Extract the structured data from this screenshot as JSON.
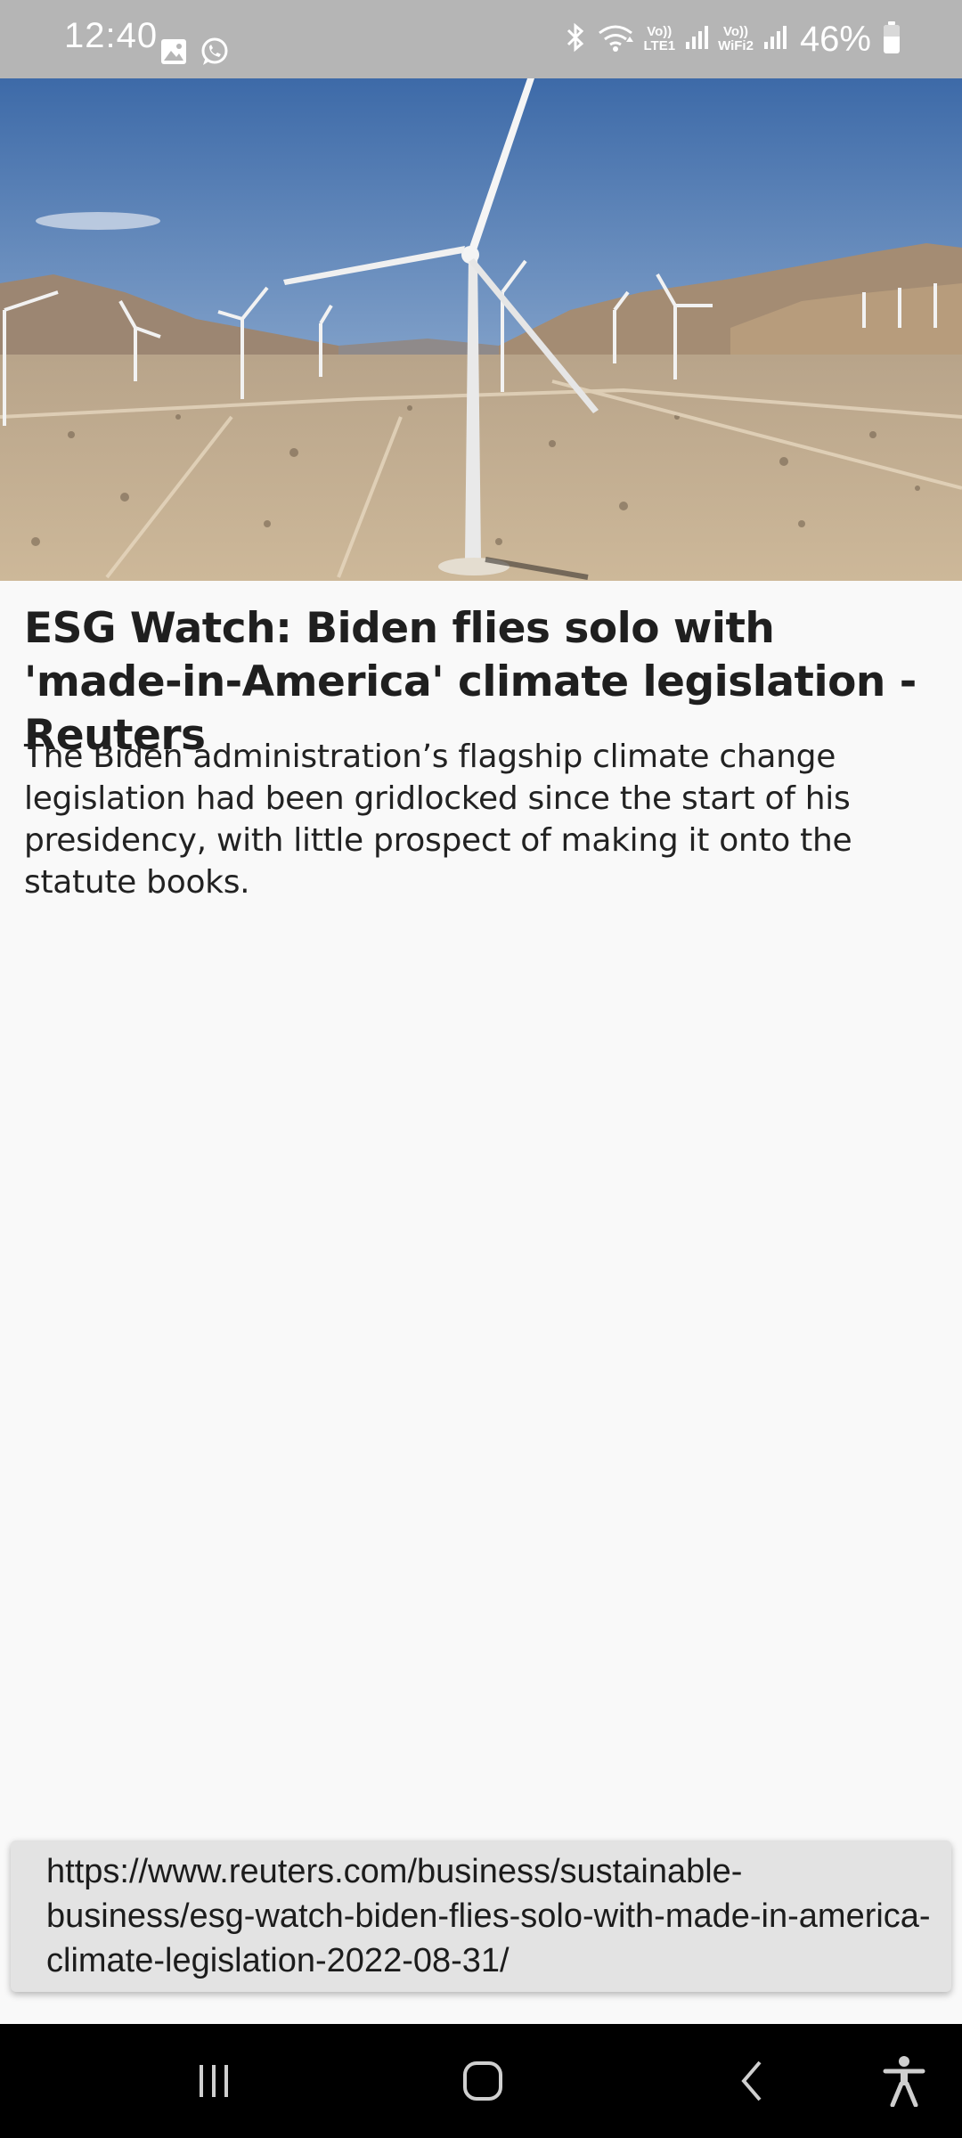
{
  "status_bar": {
    "time": "12:40",
    "network_1": {
      "top": "Vo))",
      "bottom": "LTE1"
    },
    "network_2": {
      "top": "Vo))",
      "bottom": "WiFi2"
    },
    "battery_percent": "46%",
    "icons": [
      "image-icon",
      "whatsapp-icon",
      "bluetooth-icon",
      "wifi-icon",
      "signal-icon",
      "signal-icon",
      "battery-icon"
    ]
  },
  "article": {
    "image_subject": "wind turbines in desert valley",
    "headline": "ESG Watch: Biden flies solo with 'made-in-America' climate legislation - Reuters",
    "summary": "The Biden administration’s flagship climate change legislation had been gridlocked since the start of his presidency, with little prospect of making it onto the statute books."
  },
  "url_card": {
    "url": "https://www.reuters.com/business/sustainable-business/esg-watch-biden-flies-solo-with-made-in-america-climate-legislation-2022-08-31/"
  },
  "nav_bar": {
    "icons": [
      "recent-apps-icon",
      "home-icon",
      "back-icon",
      "accessibility-icon"
    ]
  },
  "colors": {
    "status_bar": "#b5b5b5",
    "page_background": "#f9f9f9",
    "url_card": "#e3e3e3",
    "nav_bar": "#000000"
  }
}
